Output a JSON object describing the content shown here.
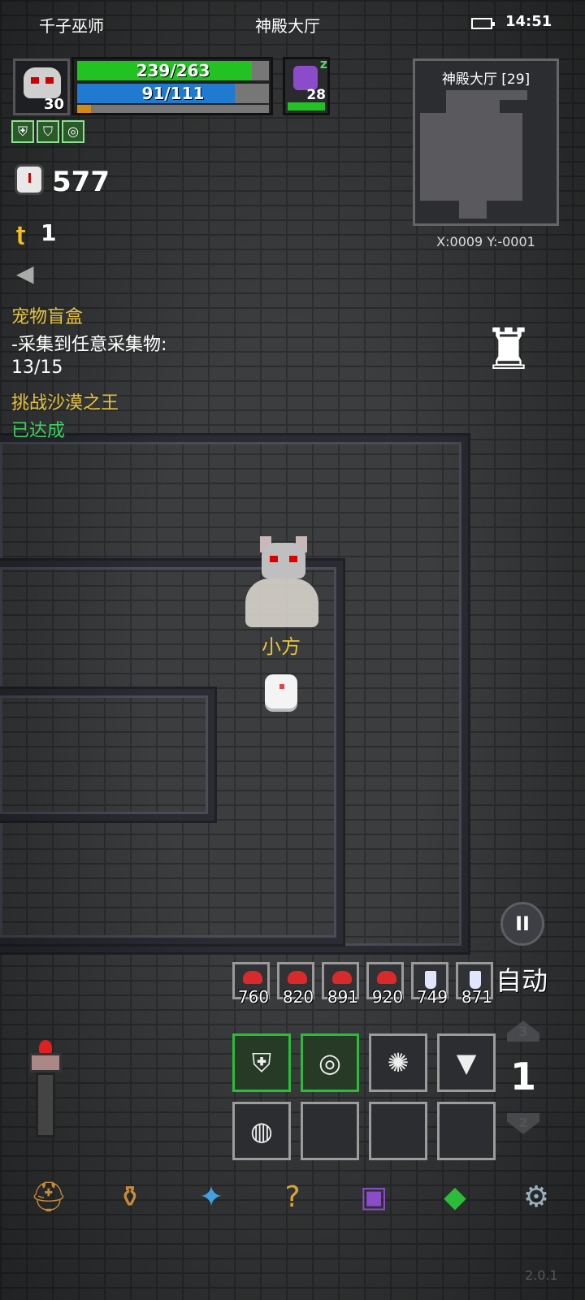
{
  "status_bar": {
    "carrier": "千子巫师",
    "location": "神殿大厅",
    "time": "14:51"
  },
  "player": {
    "level": "30",
    "hp_text": "239/263",
    "hp_fraction": 0.909,
    "mp_text": "91/111",
    "mp_fraction": 0.82,
    "xp_fraction": 0.07,
    "name": "小方"
  },
  "pet": {
    "level": "28",
    "hp_fraction": 1.0
  },
  "buffs": [
    "shield-buff-icon",
    "shield-buff-icon",
    "swirl-buff-icon"
  ],
  "counters": {
    "turns": "577",
    "keys": "1"
  },
  "quests": [
    {
      "title": "宠物盲盒",
      "line1": "-采集到任意采集物:",
      "line2": "13/15"
    },
    {
      "title": "挑战沙漠之王",
      "status": "已达成"
    }
  ],
  "minimap": {
    "title": "神殿大厅 [29]",
    "coords": "X:0009  Y:-0001"
  },
  "controls": {
    "auto_label": "自动",
    "pause_label": "II"
  },
  "quickbar": [
    {
      "icon": "meat-icon",
      "count": "760"
    },
    {
      "icon": "meat-icon",
      "count": "820"
    },
    {
      "icon": "meat-icon",
      "count": "891"
    },
    {
      "icon": "meat-icon",
      "count": "920"
    },
    {
      "icon": "potion-icon",
      "count": "749"
    },
    {
      "icon": "potion-icon",
      "count": "871"
    }
  ],
  "floor": {
    "up": "3",
    "current": "1",
    "down": "2"
  },
  "version": "2.0.1",
  "colors": {
    "hp": "#22c222",
    "mp": "#1f7ad0",
    "xp": "#d08a1b",
    "quest_title": "#e8c33a",
    "quest_done": "#3bd35c"
  }
}
